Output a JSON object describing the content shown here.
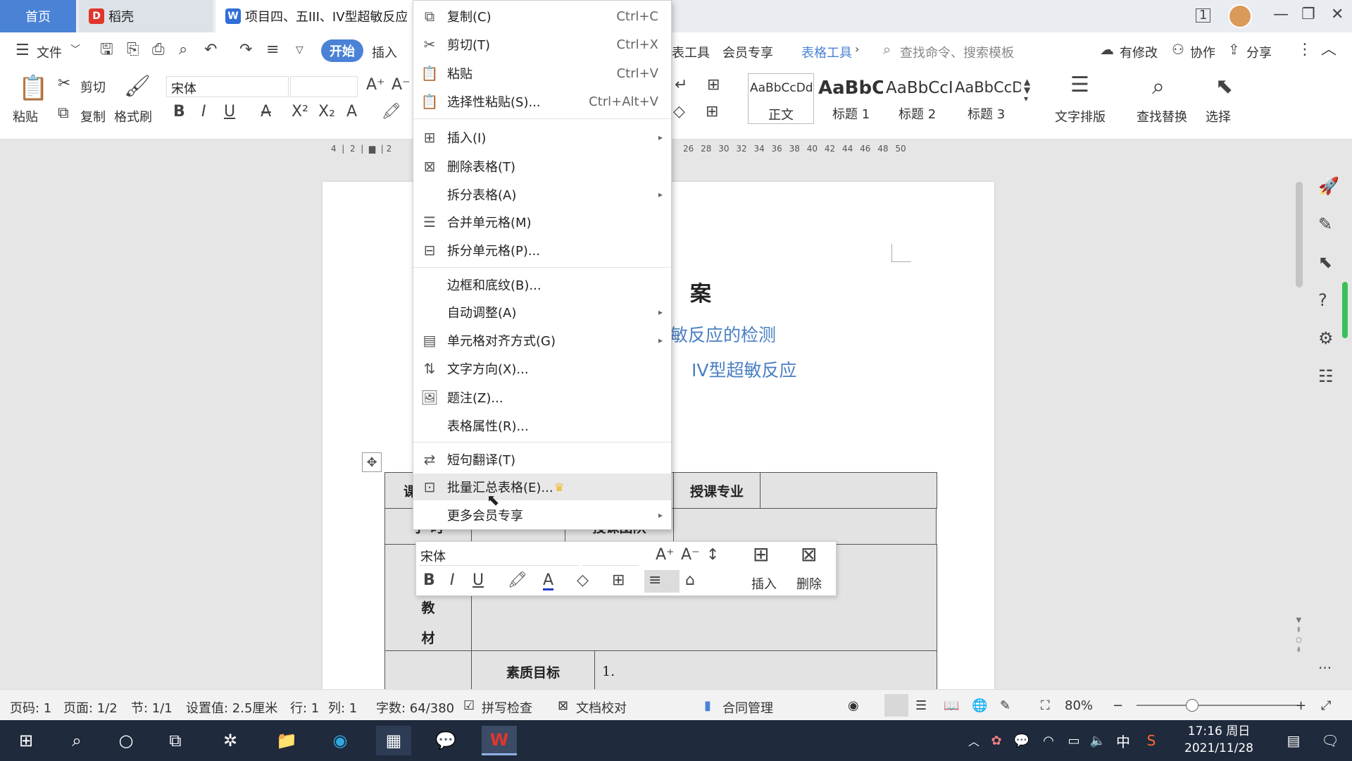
{
  "tabs": {
    "home": "首页",
    "daoke": "稻壳",
    "doc": "项目四、五III、IV型超敏反应"
  },
  "menubar": {
    "file": "文件",
    "start": "开始",
    "insert": "插入",
    "tools": "表工具",
    "member": "会员专享",
    "table_tools": "表格工具",
    "search_placeholder": "查找命令、搜索模板",
    "modified": "有修改",
    "collab": "协作",
    "share": "分享"
  },
  "ribbon": {
    "paste": "粘贴",
    "cut": "剪切",
    "copy": "复制",
    "format_painter": "格式刷",
    "font": "宋体",
    "style_preview_normal": "AaBbCcDd",
    "style_preview_h1": "AaBbC",
    "style_preview_h2": "AaBbCcI",
    "style_preview_h3": "AaBbCcDc",
    "style_normal": "正文",
    "style_h1": "标题 1",
    "style_h2": "标题 2",
    "style_h3": "标题 3",
    "text_layout": "文字排版",
    "find_replace": "查找替换",
    "select": "选择"
  },
  "ruler": {
    "left_ticks": [
      "4",
      "2",
      "2"
    ],
    "right_ticks": [
      "26",
      "28",
      "30",
      "32",
      "34",
      "36",
      "38",
      "40",
      "42",
      "44",
      "46",
      "48",
      "50"
    ]
  },
  "document": {
    "heading": "案",
    "sub1": "敏反应的检测",
    "sub2": "IV型超敏反应",
    "cell_major": "授课专业",
    "cell_course": "课",
    "cell_hours": "学 时",
    "cell_method": "授课团队",
    "cell_jiao": "教",
    "cell_cai": "材",
    "cell_quality": "素质目标",
    "cell_one": "1."
  },
  "context_menu": {
    "items": [
      {
        "label": "复制(C)",
        "shortcut": "Ctrl+C"
      },
      {
        "label": "剪切(T)",
        "shortcut": "Ctrl+X"
      },
      {
        "label": "粘贴",
        "shortcut": "Ctrl+V"
      },
      {
        "label": "选择性粘贴(S)...",
        "shortcut": "Ctrl+Alt+V"
      },
      {
        "label": "插入(I)"
      },
      {
        "label": "删除表格(T)"
      },
      {
        "label": "拆分表格(A)"
      },
      {
        "label": "合并单元格(M)"
      },
      {
        "label": "拆分单元格(P)..."
      },
      {
        "label": "边框和底纹(B)..."
      },
      {
        "label": "自动调整(A)"
      },
      {
        "label": "单元格对齐方式(G)"
      },
      {
        "label": "文字方向(X)..."
      },
      {
        "label": "题注(Z)..."
      },
      {
        "label": "表格属性(R)..."
      },
      {
        "label": "短句翻译(T)"
      },
      {
        "label": "批量汇总表格(E)..."
      },
      {
        "label": "更多会员专享"
      }
    ]
  },
  "minibar": {
    "font": "宋体",
    "insert": "插入",
    "delete": "删除"
  },
  "statusbar": {
    "page_num": "页码: 1",
    "pages": "页面: 1/2",
    "section": "节: 1/1",
    "setting": "设置值: 2.5厘米",
    "row": "行: 1",
    "col": "列: 1",
    "words": "字数: 64/380",
    "spell": "拼写检查",
    "proof": "文档校对",
    "contract": "合同管理",
    "zoom": "80%"
  },
  "taskbar": {
    "time": "17:16 周日",
    "date": "2021/11/28",
    "ime": "中"
  },
  "colors": {
    "accent": "#4a82d6",
    "subtitle_blue": "#4a7fc1",
    "taskbar": "#1f2a3c"
  }
}
